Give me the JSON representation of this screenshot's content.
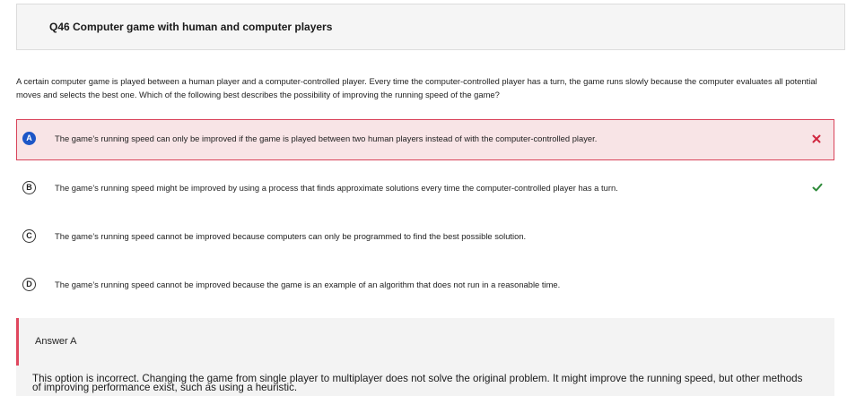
{
  "question": {
    "title": "Q46 Computer game with human and computer players",
    "stem": "A certain computer game is played between a human player and a computer-controlled player. Every time the computer-controlled player has a turn, the game runs slowly because the computer evaluates all potential moves and selects the best one. Which of the following best describes the possibility of improving the running speed of the game?"
  },
  "options": [
    {
      "letter": "A",
      "text": "The game’s running speed can only be improved if the game is played between two human players instead of with the computer-controlled player.",
      "state": "selected-incorrect",
      "mark_icon": "cross-icon",
      "mark_color": "#d0263f"
    },
    {
      "letter": "B",
      "text": "The game’s running speed might be improved by using a process that finds approximate solutions every time the computer-controlled player has a turn.",
      "state": "correct",
      "mark_icon": "checkmark-icon",
      "mark_color": "#2e8b3a"
    },
    {
      "letter": "C",
      "text": "The game’s running speed cannot be improved because computers can only be programmed to find the best possible solution.",
      "state": "unselected"
    },
    {
      "letter": "D",
      "text": "The game’s running speed cannot be improved because the game is an example of an algorithm that does not run in a reasonable time.",
      "state": "unselected"
    }
  ],
  "answer": {
    "label": "Answer A",
    "explanation": "This option is incorrect. Changing the game from single player to multiplayer does not solve the original problem. It might improve the running speed, but other methods of improving performance exist, such as using a heuristic."
  },
  "colors": {
    "selected_letter_bg": "#1c56c7",
    "wrong_border": "#d9435a",
    "wrong_bg": "#f8e4e6",
    "answer_accent": "#e0475e"
  }
}
